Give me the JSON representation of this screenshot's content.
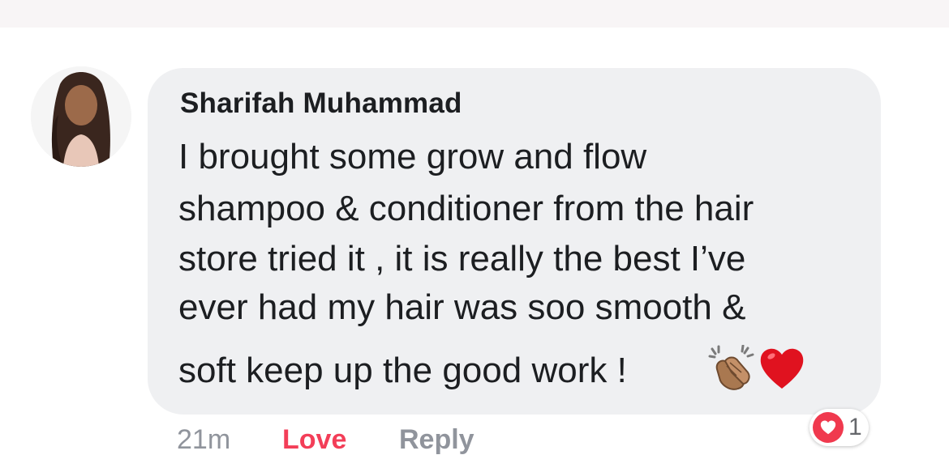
{
  "comment": {
    "author": "Sharifah Muhammad",
    "lines": [
      "I brought some grow and flow",
      "shampoo & conditioner from the hair",
      "store tried it , it is really the best I’ve",
      "ever had my hair was soo smooth &",
      "soft keep up the good work !"
    ],
    "emojis": [
      "clapping-hands-emoji",
      "red-heart-emoji"
    ],
    "timestamp": "21m",
    "love_label": "Love",
    "reply_label": "Reply",
    "reaction": {
      "icon": "love-reaction-icon",
      "count": "1",
      "color": "#f0394e"
    }
  },
  "colors": {
    "bubble": "#eff0f2",
    "love": "#f33e58",
    "muted": "#90949c",
    "text": "#1c1e21"
  }
}
